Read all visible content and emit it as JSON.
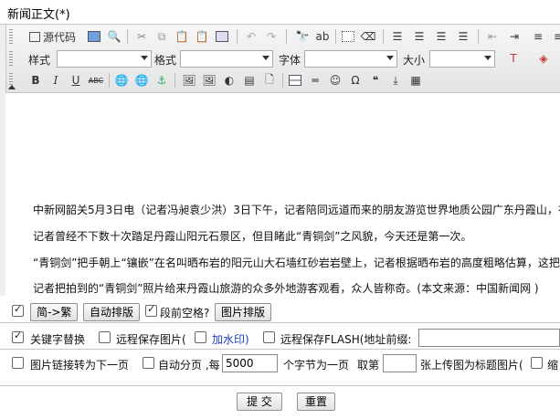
{
  "field_label": "新闻正文(*)",
  "toolbar": {
    "source_label": "源代码",
    "style_label": "样式",
    "format_label": "格式",
    "font_label": "字体",
    "size_label": "大小",
    "style_value": "",
    "format_value": "",
    "font_value": "",
    "size_value": ""
  },
  "content": {
    "paragraphs": [
      "中新网韶关5月3日电（记者冯昶袁少洪）3日下午，记者陪同远道而来的朋友游览世界地质公园广东丹霞山，在",
      "记者曾经不下数十次踏足丹霞山阳元石景区，但目睹此“青铜剑”之风貌，今天还是第一次。",
      "“青铜剑”把手朝上“镶嵌”在名叫晒布岩的阳元山大石墙红砂岩岩壁上，记者根据晒布岩的高度粗略估算，这把巨",
      "记者把拍到的“青铜剑”照片给来丹霞山旅游的众多外地游客观看，众人皆称奇。(本文来源：中国新闻网 )"
    ]
  },
  "options": {
    "simp_trad_label": "简->繁",
    "auto_format_label": "自动排版",
    "indent_label": "段前空格?",
    "image_layout_label": "图片排版",
    "keyword_label": "关键字替换",
    "remote_image_label": "远程保存图片(",
    "watermark_label": "加水印)",
    "remote_flash_label": "远程保存FLASH(地址前缀:",
    "remote_flash_prefix": "",
    "img_link_label": "图片链接转为下一页",
    "auto_page_label": "自动分页 ,每",
    "page_size_value": "5000",
    "page_size_suffix": "个字节为一页",
    "take_label": "取第",
    "take_value": "",
    "title_img_label": "张上传图为标题图片(",
    "thumb_label": "缩"
  },
  "actions": {
    "submit_label": "提 交",
    "reset_label": "重置"
  },
  "colors": {
    "toolbar_bg": "#eeeeee",
    "link_blue": "#1a3fc0"
  }
}
